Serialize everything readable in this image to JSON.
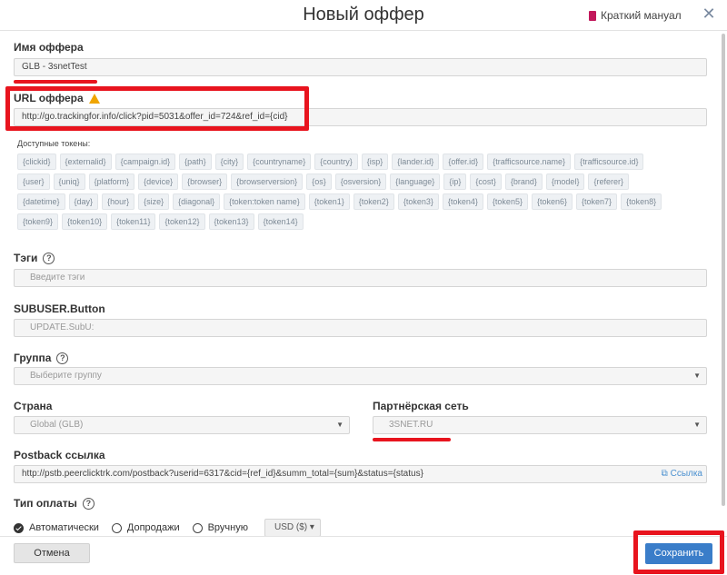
{
  "header": {
    "title": "Новый оффер",
    "manual_label": "Краткий мануал",
    "close_glyph": "✕"
  },
  "offer_name": {
    "label": "Имя оффера",
    "value": "GLB - 3snetTest"
  },
  "offer_url": {
    "label": "URL оффера",
    "value": "http://go.trackingfor.info/click?pid=5031&offer_id=724&ref_id={cid}"
  },
  "tokens": {
    "title": "Доступные токены:",
    "items": [
      "{clickid}",
      "{externalid}",
      "{campaign.id}",
      "{path}",
      "{city}",
      "{countryname}",
      "{country}",
      "{isp}",
      "{lander.id}",
      "{offer.id}",
      "{trafficsource.name}",
      "{trafficsource.id}",
      "{user}",
      "{uniq}",
      "{platform}",
      "{device}",
      "{browser}",
      "{browserversion}",
      "{os}",
      "{osversion}",
      "{language}",
      "{ip}",
      "{cost}",
      "{brand}",
      "{model}",
      "{referer}",
      "{datetime}",
      "{day}",
      "{hour}",
      "{size}",
      "{diagonal}",
      "{token:token name}",
      "{token1}",
      "{token2}",
      "{token3}",
      "{token4}",
      "{token5}",
      "{token6}",
      "{token7}",
      "{token8}",
      "{token9}",
      "{token10}",
      "{token11}",
      "{token12}",
      "{token13}",
      "{token14}"
    ]
  },
  "tags": {
    "label": "Тэги",
    "placeholder": "Введите тэги"
  },
  "subuser": {
    "label": "SUBUSER.Button",
    "placeholder": "UPDATE.SubU:"
  },
  "group": {
    "label": "Группа",
    "placeholder": "Выберите группу"
  },
  "country": {
    "label": "Страна",
    "value": "Global (GLB)"
  },
  "network": {
    "label": "Партнёрская сеть",
    "value": "3SNET.RU"
  },
  "postback": {
    "label": "Postback ссылка",
    "value": "http://pstb.peerclicktrk.com/postback?userid=6317&cid={ref_id}&summ_total={sum}&status={status}",
    "link_label": "Ссылка"
  },
  "payment": {
    "label": "Тип оплаты",
    "options": [
      "Автоматически",
      "Допродажи",
      "Вручную"
    ],
    "currency": "USD ($)"
  },
  "footer": {
    "cancel_label": "Отмена",
    "save_label": "Сохранить"
  },
  "colors": {
    "accent": "#3a7dc9",
    "annotation": "#e8141e",
    "warning": "#f0a500",
    "manual_icon": "#c2185b"
  }
}
